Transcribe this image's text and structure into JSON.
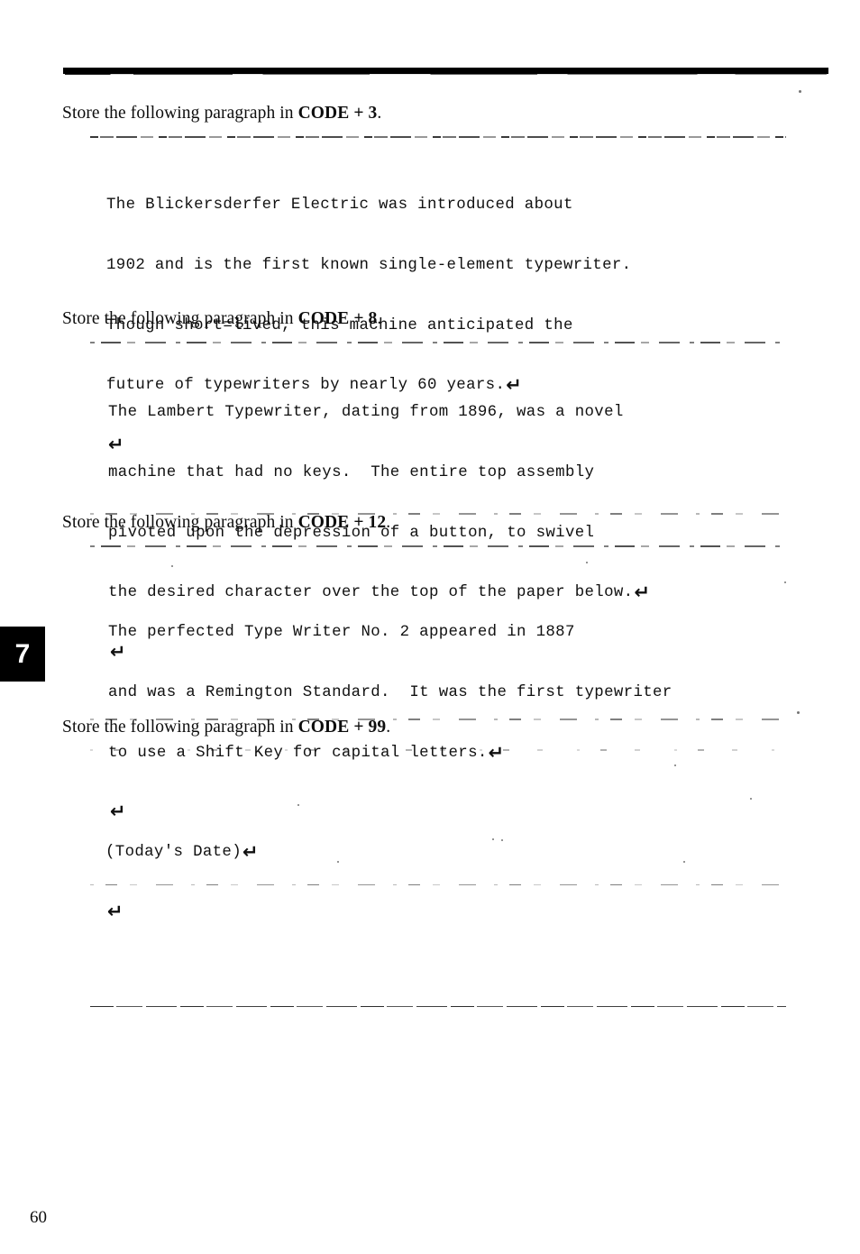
{
  "page": {
    "chapter_tab": "7",
    "folio": "60"
  },
  "exercises": [
    {
      "instruction_prefix": "Store the following paragraph in ",
      "instruction_code": "CODE + 3",
      "instruction_suffix": ".",
      "lines": [
        "The Blickersderfer Electric was introduced about",
        "1902 and is the first known single-element typewriter.",
        "Though short=lived, this machine anticipated the",
        "future of typewriters by nearly 60 years."
      ],
      "return_symbol": "↵",
      "trailing_return": "↵"
    },
    {
      "instruction_prefix": "Store the following paragraph in ",
      "instruction_code": "CODE + 8",
      "instruction_suffix": ".",
      "lines": [
        "The Lambert Typewriter, dating from 1896, was a novel",
        "machine that had no keys.  The entire top assembly",
        "pivoted upon the depression of a button, to swivel",
        "the desired character over the top of the paper below."
      ],
      "return_symbol": "↵",
      "trailing_return": "↵"
    },
    {
      "instruction_prefix": "Store the following paragraph in ",
      "instruction_code": "CODE + 12",
      "instruction_suffix": ".",
      "lines": [
        "The perfected Type Writer No. 2 appeared in 1887",
        "and was a Remington Standard.  It was the first typewriter",
        "to use a Shift Key for capital letters."
      ],
      "return_symbol": "↵",
      "trailing_return": "↵"
    },
    {
      "instruction_prefix": "Store the following paragraph in ",
      "instruction_code": "CODE + 99",
      "instruction_suffix": ".",
      "lines": [
        "(Today's Date)"
      ],
      "return_symbol": "↵",
      "trailing_return": "↵"
    }
  ]
}
